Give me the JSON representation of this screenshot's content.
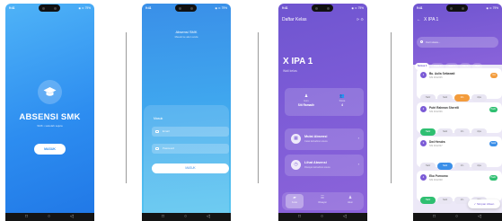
{
  "status_bar": {
    "time": "9:41",
    "icons": "◉ ⊙ 79%"
  },
  "phone_nav": {
    "back": "◁",
    "home": "○",
    "recent": "□"
  },
  "splash": {
    "title": "ABSENSI SMK",
    "subtitle": "SMK • sekolah sejuta",
    "button": "MASUK",
    "logo_icon": "graduation-cap-icon"
  },
  "login": {
    "title": "Absensi SMK",
    "subtitle": "Masuk ke akun anda",
    "section_label": "Masuk",
    "email_placeholder": "Email",
    "password_placeholder": "Password",
    "button": "MASUK"
  },
  "class_dashboard": {
    "header_title": "Daftar Kelas",
    "class_name": "X IPA 1",
    "class_sub": "Wali kelas",
    "teacher_label": "Guru",
    "teacher_value": "Siti Ramadh",
    "students_label": "Siswa",
    "students_value": "4",
    "menu": [
      {
        "title": "Mulai Absensi",
        "subtitle": "Catat kehadiran siswa",
        "icon": "calendar-icon"
      },
      {
        "title": "Lihat Absensi",
        "subtitle": "Riwayat kehadiran siswa",
        "icon": "history-icon"
      }
    ],
    "nav": [
      {
        "label": "Kelas",
        "icon": "home-icon"
      },
      {
        "label": "Riwayat",
        "icon": "list-icon"
      },
      {
        "label": "Akun",
        "icon": "person-icon"
      }
    ]
  },
  "attendance": {
    "title": "X IPA 1",
    "search_placeholder": "Cari siswa...",
    "chips": [
      "Semua 4",
      "Hadir 0",
      "Sakit 0",
      "Izin 0",
      "Alpa"
    ],
    "option_labels": [
      "Hadir",
      "Sakit",
      "Izin",
      "Alpa"
    ],
    "students": [
      {
        "num": "1",
        "name": "Bu. Aulia Setiawati",
        "nis": "NIS 0012345",
        "badge": "Izin",
        "badge_color": "#f39c3c",
        "selected": 2
      },
      {
        "num": "2",
        "name": "Putri Rahman Sherelli",
        "nis": "NIS 0012346",
        "badge": "Hadir",
        "badge_color": "#2fbf71",
        "selected": 0
      },
      {
        "num": "3",
        "name": "Dwi Hendra",
        "nis": "NIS 0012347",
        "badge": "Sakit",
        "badge_color": "#3b8fe8",
        "selected": 1
      },
      {
        "num": "4",
        "name": "Eko Purnomo",
        "nis": "NIS 0012348",
        "badge": "Hadir",
        "badge_color": "#2fbf71",
        "selected": 0
      }
    ],
    "fab_label": "Simpan Absen"
  },
  "colors": {
    "splash_blue": "#2d8df0",
    "purple": "#7b5bd6",
    "hadir": "#2fbf71",
    "sakit": "#3b8fe8",
    "izin": "#f39c3c"
  }
}
